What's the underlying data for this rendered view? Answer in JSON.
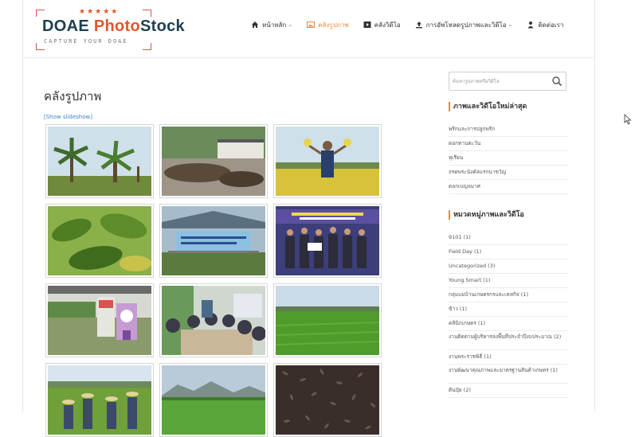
{
  "logo": {
    "stars": "★★★★★",
    "brand_part1": "DOAE ",
    "brand_part2": "Photo",
    "brand_part3": "Stock",
    "tagline": "CAPTURE YOUR DOAE"
  },
  "nav": {
    "items": [
      {
        "label": "หน้าหลัก",
        "icon": "home-icon",
        "has_dropdown": true
      },
      {
        "label": "คลังรูปภาพ",
        "icon": "image-icon",
        "active": true
      },
      {
        "label": "คลังวิดีโอ",
        "icon": "video-icon"
      },
      {
        "label": "การอัพโหลดรูปภาพและวิดีโอ",
        "icon": "upload-icon",
        "has_dropdown": true
      },
      {
        "label": "ติดต่อเรา",
        "icon": "contact-icon"
      }
    ],
    "active_color": "#f0883a"
  },
  "main": {
    "title": "คลังรูปภาพ",
    "slideshow_link": "[Show slideshow]",
    "thumbnails": [
      {
        "subject": "oil palm trees"
      },
      {
        "subject": "palm fruit pile at factory"
      },
      {
        "subject": "man in flower field"
      },
      {
        "subject": "green leaves close-up"
      },
      {
        "subject": "event banner tent"
      },
      {
        "subject": "field day group on stage"
      },
      {
        "subject": "greenhouse exhibition"
      },
      {
        "subject": "group meeting at table"
      },
      {
        "subject": "rice paddy field"
      },
      {
        "subject": "farmers in field"
      },
      {
        "subject": "green paddy landscape"
      },
      {
        "subject": "rice grains close-up"
      }
    ]
  },
  "sidebar": {
    "search_placeholder": "ค้นหารูปภาพหรือวิดีโอ",
    "recent_title": "ภาพและวิดีโอใหม่ล่าสุด",
    "recent_items": [
      "พริกและการปลูกพริก",
      "ดอกทานตะวัน",
      "ทุเรียน",
      "จรดพระนังคัลแรกนาขวัญ",
      "ดอกเบญจมาศ"
    ],
    "category_title": "หมวดหมู่ภาพและวิดีโอ",
    "categories": [
      "9101 (1)",
      "Field Day (1)",
      "Uncategorized (3)",
      "Young Smart (1)",
      "กลุ่มแม่บ้านเกษตรกรและเคหกิจ (1)",
      "ข้าว (1)",
      "คลินิกเกษตร (1)",
      "งานติดตามผู้บริหารลงพื้นที่ประจำปีงบประมาณ (2)",
      "งานพระราชพิธี (1)",
      "งานพัฒนาคุณภาพและมาตรฐานสินค้าเกษตร (1)",
      "ดินปุ๋ย (2)"
    ]
  }
}
